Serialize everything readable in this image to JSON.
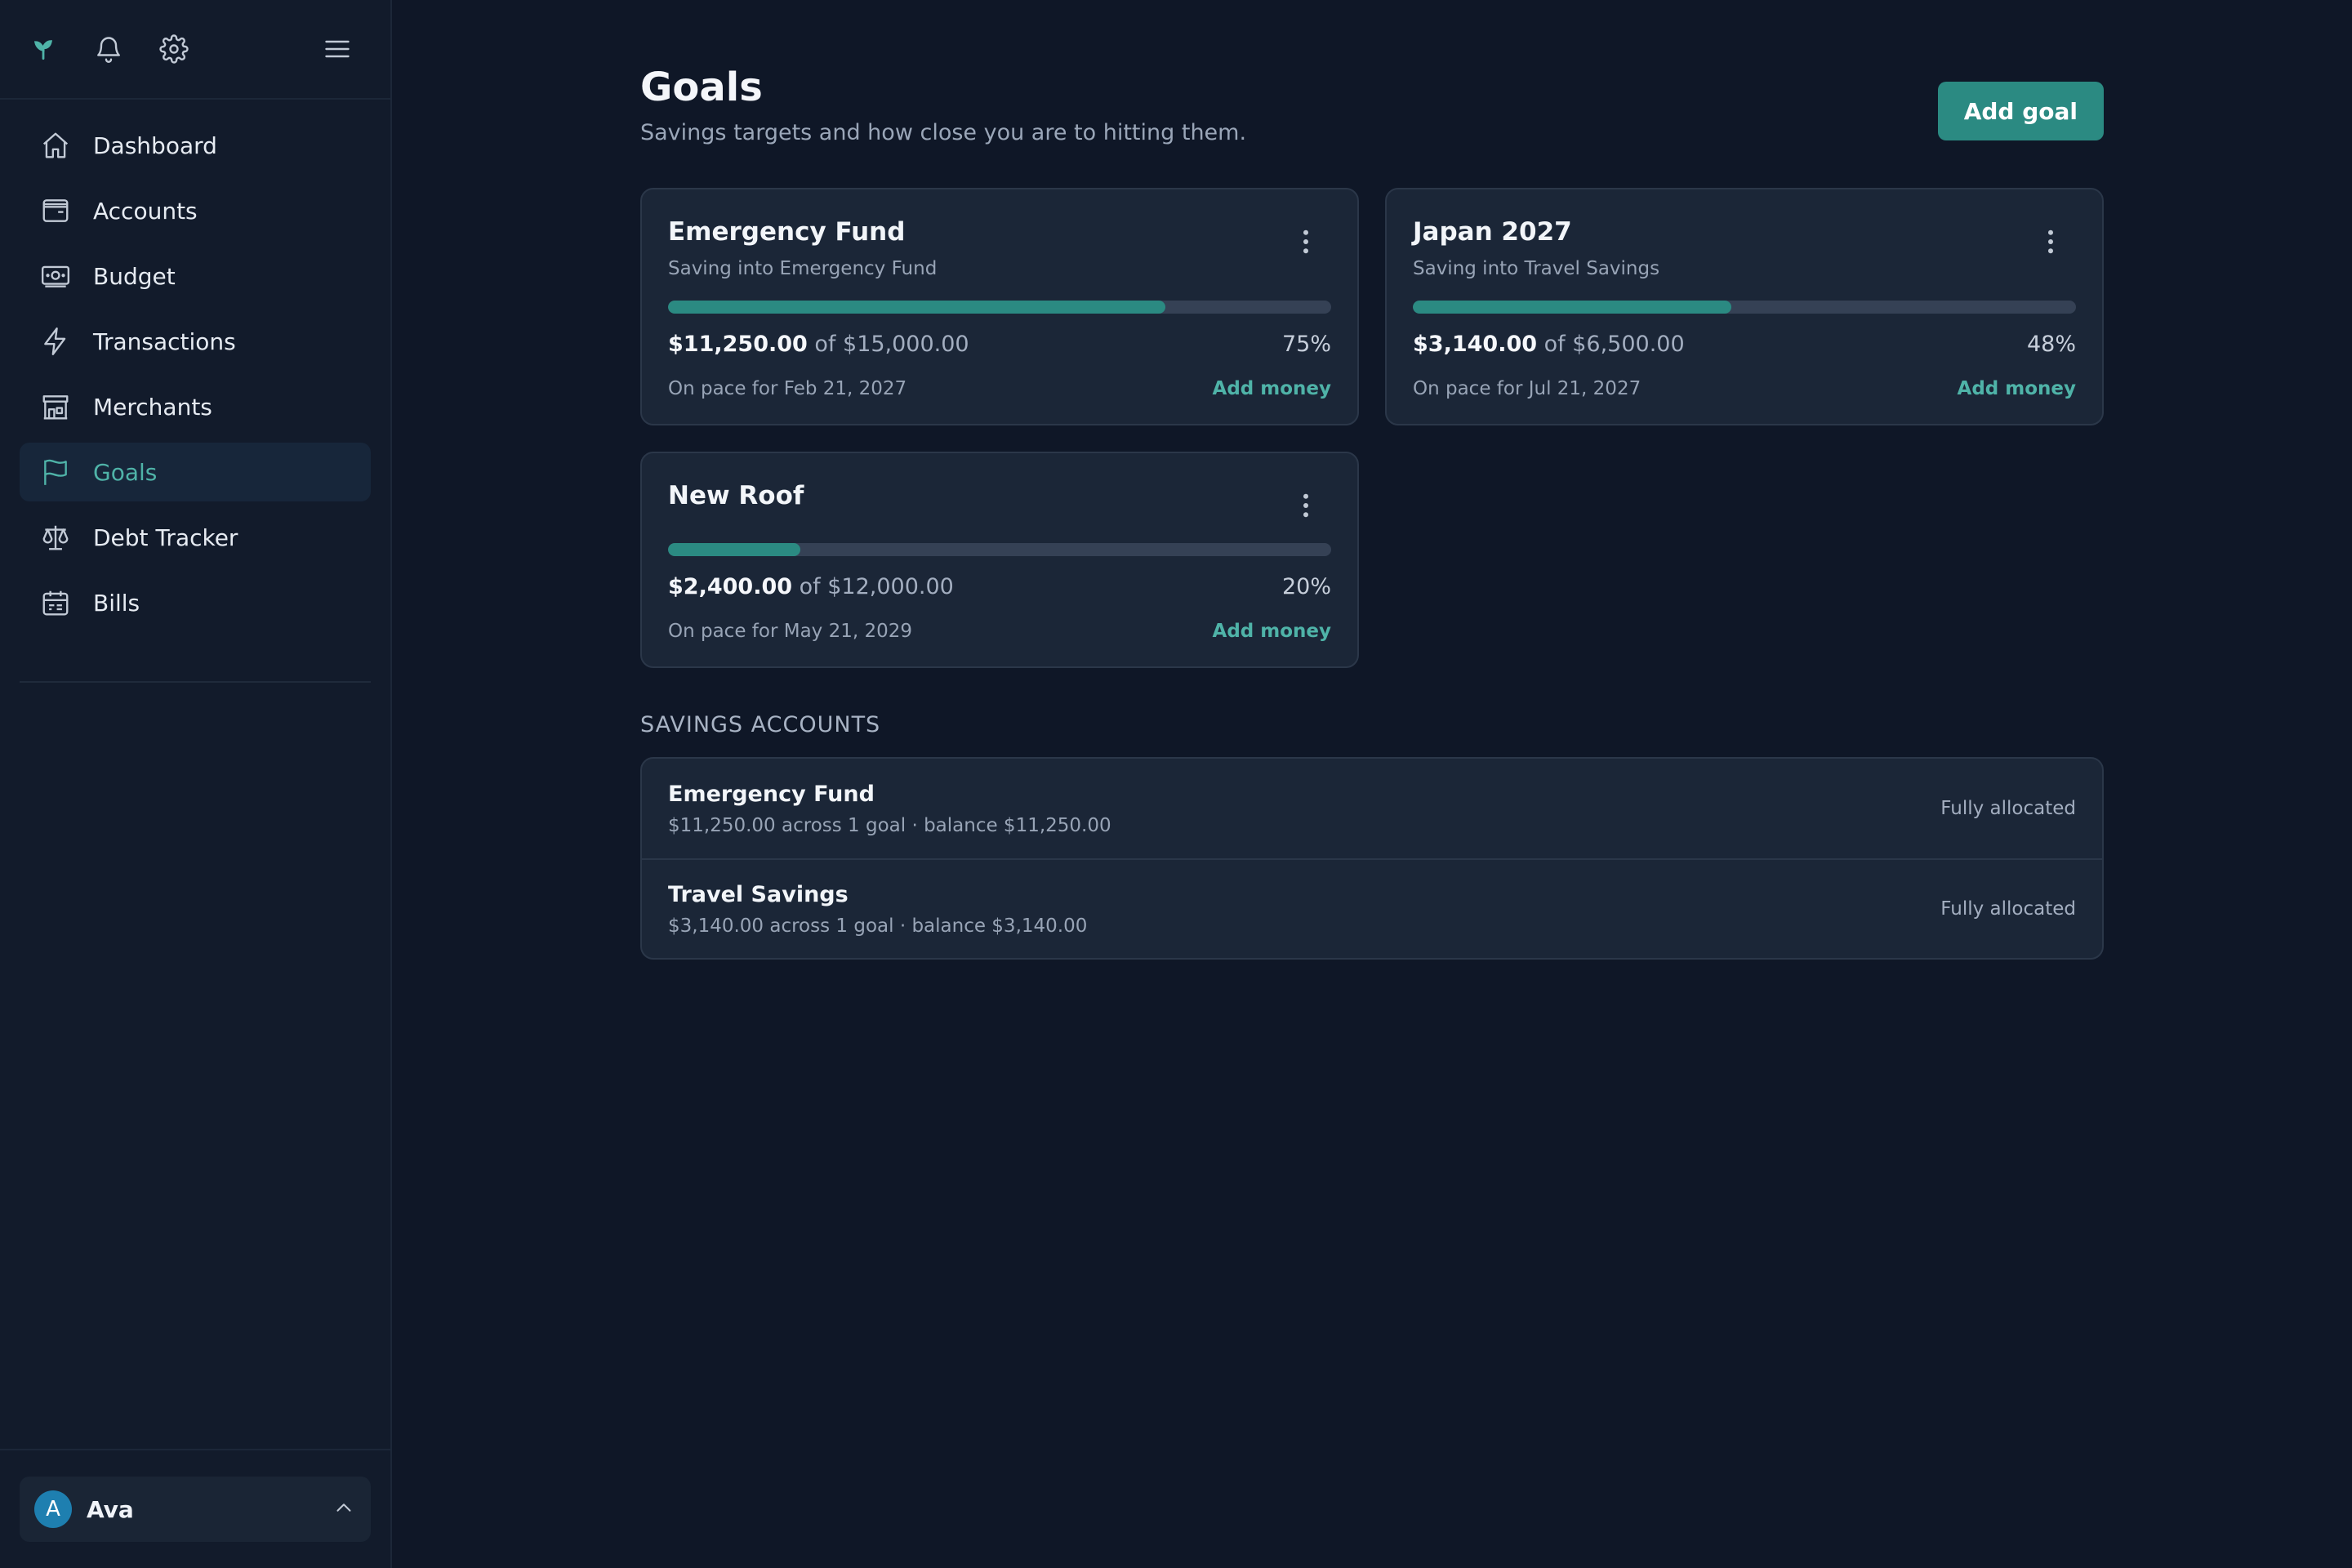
{
  "sidebar": {
    "nav": [
      {
        "label": "Dashboard",
        "icon": "home-icon"
      },
      {
        "label": "Accounts",
        "icon": "wallet-icon"
      },
      {
        "label": "Budget",
        "icon": "banknote-icon"
      },
      {
        "label": "Transactions",
        "icon": "lightning-icon"
      },
      {
        "label": "Merchants",
        "icon": "storefront-icon"
      },
      {
        "label": "Goals",
        "icon": "flag-icon",
        "active": true
      },
      {
        "label": "Debt Tracker",
        "icon": "scale-icon"
      },
      {
        "label": "Bills",
        "icon": "calendar-icon"
      }
    ],
    "user": {
      "initial": "A",
      "name": "Ava"
    }
  },
  "header": {
    "title": "Goals",
    "subtitle": "Savings targets and how close you are to hitting them.",
    "add_goal_label": "Add goal"
  },
  "goals": [
    {
      "name": "Emergency Fund",
      "subtitle": "Saving into Emergency Fund",
      "saved": "$11,250.00",
      "target_text": "of $15,000.00",
      "percent_label": "75%",
      "progress": 0.75,
      "pace": "On pace for Feb 21, 2027",
      "action": "Add money"
    },
    {
      "name": "Japan 2027",
      "subtitle": "Saving into Travel Savings",
      "saved": "$3,140.00",
      "target_text": "of $6,500.00",
      "percent_label": "48%",
      "progress": 0.48,
      "pace": "On pace for Jul 21, 2027",
      "action": "Add money"
    },
    {
      "name": "New Roof",
      "subtitle": "",
      "saved": "$2,400.00",
      "target_text": "of $12,000.00",
      "percent_label": "20%",
      "progress": 0.2,
      "pace": "On pace for May 21, 2029",
      "action": "Add money"
    }
  ],
  "savings": {
    "section_label": "SAVINGS ACCOUNTS",
    "rows": [
      {
        "name": "Emergency Fund",
        "detail": "$11,250.00 across 1 goal · balance $11,250.00",
        "status": "Fully allocated"
      },
      {
        "name": "Travel Savings",
        "detail": "$3,140.00 across 1 goal · balance $3,140.00",
        "status": "Fully allocated"
      }
    ]
  },
  "colors": {
    "accent": "#2b8a82",
    "accent_text": "#4fb3a8",
    "background": "#0f1727",
    "card": "#1b2637"
  }
}
